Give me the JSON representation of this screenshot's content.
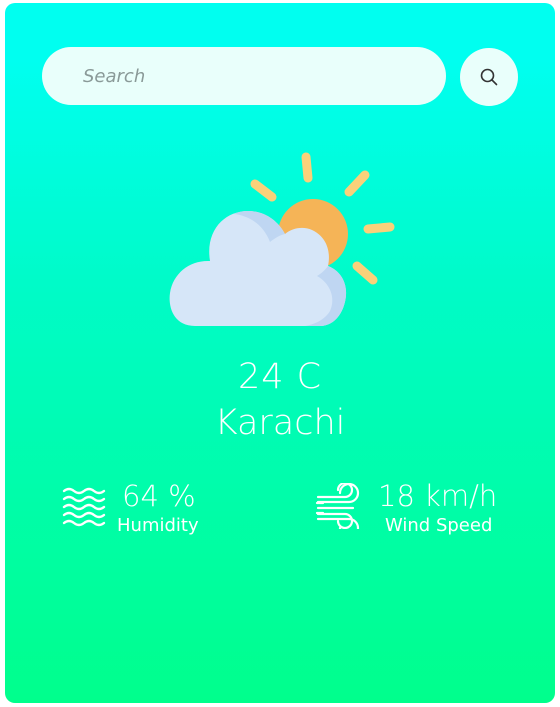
{
  "search": {
    "placeholder": "Search",
    "button_icon": "search-icon"
  },
  "weather": {
    "icon": "partly-cloudy-icon",
    "temperature": "24 C",
    "city": "Karachi"
  },
  "details": {
    "humidity": {
      "icon": "humidity-waves-icon",
      "value": "64 %",
      "label": "Humidity"
    },
    "wind": {
      "icon": "wind-icon",
      "value": "18 km/h",
      "label": "Wind Speed"
    }
  },
  "colors": {
    "gradient_top": "#00fff0",
    "gradient_bottom": "#00ff8c",
    "text": "#ffffff",
    "input_bg": "#e9fffb",
    "sun": "#f5b457",
    "sun_rays": "#fad17a",
    "cloud": "#d6e6f8"
  }
}
